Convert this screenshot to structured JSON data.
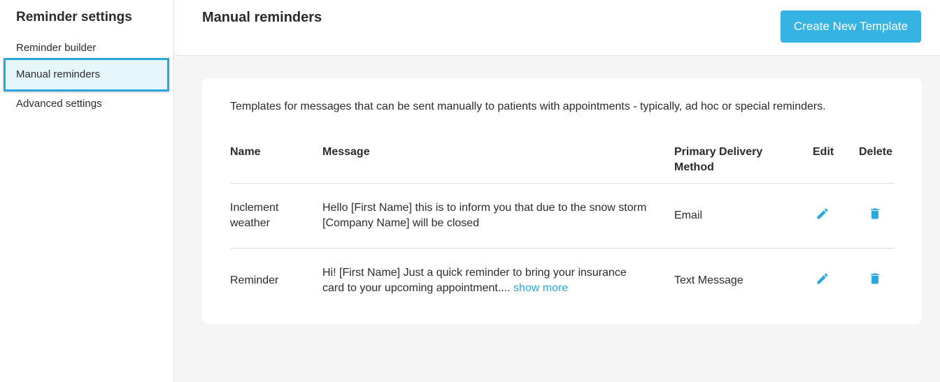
{
  "sidebar": {
    "title": "Reminder settings",
    "items": [
      {
        "label": "Reminder builder"
      },
      {
        "label": "Manual reminders"
      },
      {
        "label": "Advanced settings"
      }
    ]
  },
  "header": {
    "title": "Manual reminders",
    "create_label": "Create New Template"
  },
  "main": {
    "description": "Templates for messages that can be sent manually to patients with appointments - typically, ad hoc or special reminders.",
    "columns": {
      "name": "Name",
      "message": "Message",
      "method": "Primary Delivery Method",
      "edit": "Edit",
      "delete": "Delete"
    },
    "rows": [
      {
        "name": "Inclement weather",
        "message": "Hello [First Name] this is to inform you that due to the snow storm [Company Name] will be closed",
        "method": "Email"
      },
      {
        "name": "Reminder",
        "message": "Hi! [First Name] Just a quick reminder to bring your insurance card to your upcoming appointment....",
        "show_more": "show more",
        "method": "Text Message"
      }
    ]
  },
  "colors": {
    "accent": "#35b3e3",
    "active_bg": "#e6f7fc",
    "active_border": "#29a9d9",
    "page_bg": "#f5f5f5"
  },
  "icons": {
    "edit": "pencil-icon",
    "delete": "trash-icon"
  }
}
